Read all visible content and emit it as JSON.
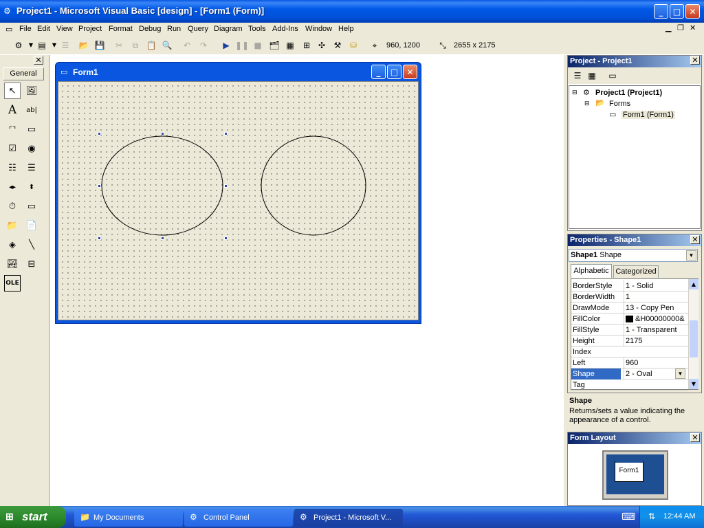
{
  "window": {
    "title": "Project1 - Microsoft Visual Basic [design] - [Form1 (Form)]",
    "icon": "vb-icon",
    "buttons": [
      "_",
      "□",
      "×"
    ]
  },
  "menu": {
    "items": [
      "File",
      "Edit",
      "View",
      "Project",
      "Format",
      "Debug",
      "Run",
      "Query",
      "Diagram",
      "Tools",
      "Add-Ins",
      "Window",
      "Help"
    ]
  },
  "toolbar": {
    "position": "960, 1200",
    "size": "2655 x 2175"
  },
  "toolbox": {
    "title": "General"
  },
  "form": {
    "title": "Form1"
  },
  "project_panel": {
    "title": "Project - Project1",
    "tree": {
      "root": "Project1 (Project1)",
      "folder": "Forms",
      "item": "Form1 (Form1)"
    }
  },
  "properties_panel": {
    "title": "Properties - Shape1",
    "object_name": "Shape1",
    "object_type": "Shape",
    "tabs": [
      "Alphabetic",
      "Categorized"
    ],
    "rows": [
      {
        "name": "BorderStyle",
        "value": "1 - Solid"
      },
      {
        "name": "BorderWidth",
        "value": "1"
      },
      {
        "name": "DrawMode",
        "value": "13 - Copy Pen"
      },
      {
        "name": "FillColor",
        "value": "&H00000000&"
      },
      {
        "name": "FillStyle",
        "value": "1 - Transparent"
      },
      {
        "name": "Height",
        "value": "2175"
      },
      {
        "name": "Index",
        "value": ""
      },
      {
        "name": "Left",
        "value": "960"
      },
      {
        "name": "Shape",
        "value": "2 - Oval"
      },
      {
        "name": "Tag",
        "value": ""
      }
    ],
    "description_title": "Shape",
    "description_text": "Returns/sets a value indicating the appearance of a control."
  },
  "form_layout": {
    "title": "Form Layout",
    "form_label": "Form1"
  },
  "taskbar": {
    "start": "start",
    "items": [
      "My Documents",
      "Control Panel",
      "Project1 - Microsoft V..."
    ],
    "clock": "12:44 AM"
  }
}
